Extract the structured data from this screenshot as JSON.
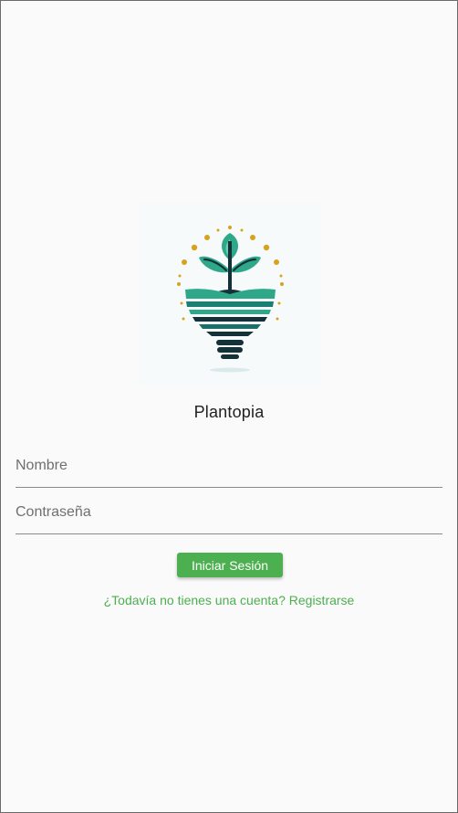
{
  "app": {
    "name": "Plantopia",
    "logo_icon": "plant-lightbulb-icon"
  },
  "form": {
    "username_placeholder": "Nombre",
    "password_placeholder": "Contraseña",
    "username_value": "",
    "password_value": ""
  },
  "actions": {
    "login_label": "Iniciar Sesión",
    "register_link": "¿Todavía no tienes una cuenta? Registrarse"
  },
  "colors": {
    "accent": "#4caf50",
    "background": "#fafafa",
    "logo_teal": "#1f9e82",
    "logo_dark": "#14313a",
    "logo_gold": "#d8a21e"
  }
}
